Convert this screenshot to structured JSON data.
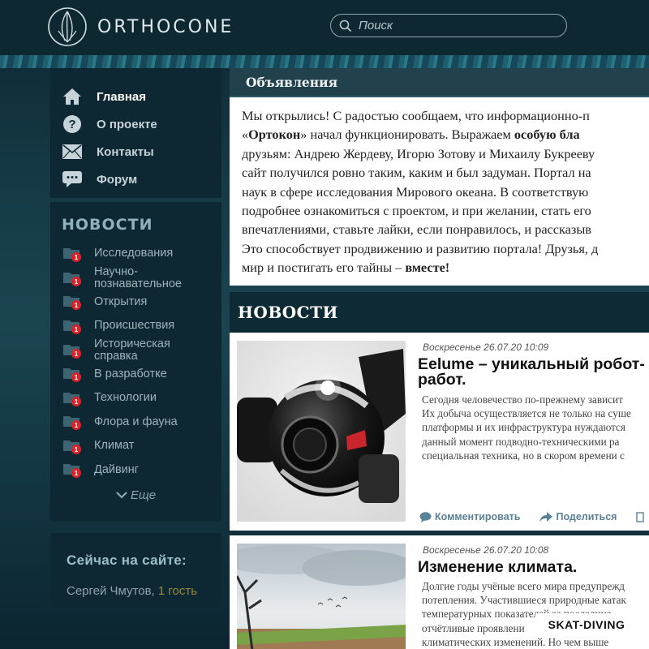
{
  "header": {
    "logo_text": "ORTHOCONE",
    "search_placeholder": "Поиск"
  },
  "nav": {
    "items": [
      {
        "label": "Главная",
        "icon": "home-icon"
      },
      {
        "label": "О проекте",
        "icon": "question-icon"
      },
      {
        "label": "Контакты",
        "icon": "envelope-icon"
      },
      {
        "label": "Форум",
        "icon": "chat-icon"
      }
    ]
  },
  "news_sidebar": {
    "title": "НОВОСТИ",
    "categories": [
      {
        "label": "Исследования",
        "badge": "1"
      },
      {
        "label": "Научно-\nпознавательное",
        "badge": "1"
      },
      {
        "label": "Открытия",
        "badge": "1"
      },
      {
        "label": "Происшествия",
        "badge": "1"
      },
      {
        "label": "Историческая\nсправка",
        "badge": "1"
      },
      {
        "label": "В разработке",
        "badge": "1"
      },
      {
        "label": "Технологии",
        "badge": "1"
      },
      {
        "label": "Флора и фауна",
        "badge": "1"
      },
      {
        "label": "Климат",
        "badge": "1"
      },
      {
        "label": "Дайвинг",
        "badge": "1"
      }
    ],
    "more": "Еще"
  },
  "online": {
    "title": "Сейчас на сайте:",
    "user": "Сергей Чмутов,",
    "guest": "1 гость"
  },
  "announcements": {
    "title": "Объявления",
    "lines": [
      [
        "Мы открылись! С радостью сообщаем, что информационно-п"
      ],
      [
        "«",
        "Ортокон",
        "» начал функционировать.  Выражаем ",
        "особую бла"
      ],
      [
        "друзьям: Андрею Жердеву, Игорю Зотову и Михаилу Букрееву"
      ],
      [
        "сайт получился ровно таким, каким и был задуман. Портал на"
      ],
      [
        "наук в сфере исследования Мирового океана. В соответствую"
      ],
      [
        "подробнее ознакомиться с проектом, и при желании, стать его"
      ],
      [
        "впечатлениями, ставьте лайки, если понравилось, и рассказыв"
      ],
      [
        "Это способствует продвижению и развитию портала! Друзья, д"
      ],
      [
        "мир и постигать его тайны  – ",
        "вместе!"
      ]
    ]
  },
  "news_main": {
    "title": "НОВОСТИ",
    "cards": [
      {
        "date": "Воскресенье 26.07.20 10:09",
        "title_lines": [
          "Eelume – уникальный робот-",
          "работ."
        ],
        "text_lines": [
          "Сегодня человечество по-прежнему зависит",
          "Их добыча осуществляется не только на суше",
          "платформы и их инфраструктура нуждаются",
          "данный момент подводно-техническими ра",
          "специальная техника, но в скором времени с"
        ],
        "comment_label": "Комментировать",
        "share_label": "Поделиться"
      },
      {
        "date": "Воскресенье 26.07.20 10:08",
        "title_lines": [
          "Изменение климата."
        ],
        "text_lines": [
          "Долгие годы учёные всего мира предупрежд",
          "потепления. Участившиеся природные катак",
          "температурных показателей за последние",
          "отчётливые проявлени",
          "климатических изменений. Но чем выше"
        ]
      }
    ]
  },
  "watermark": "SKAT-DIVING",
  "colors": {
    "panel": "#0d2833",
    "badge": "#d8232a",
    "accent": "#5a8296"
  }
}
